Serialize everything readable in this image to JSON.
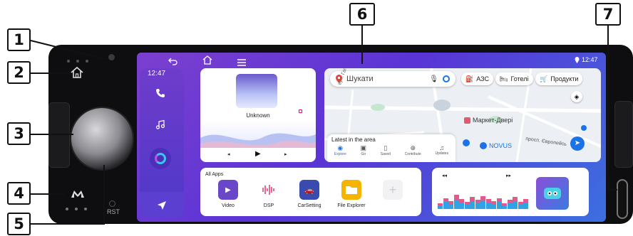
{
  "callouts": [
    "1",
    "2",
    "3",
    "4",
    "5",
    "6",
    "7"
  ],
  "device": {
    "rst_label": "RST",
    "brand_icon": "m-logo-icon"
  },
  "status_bar": {
    "time": "12:47",
    "location_icon": "location-pin-icon"
  },
  "sidebar": {
    "time": "12:47",
    "icons": [
      "phone-icon",
      "music-note-icon",
      "voice-assistant-icon",
      "navigation-arrow-icon"
    ]
  },
  "top_nav_icons": [
    "back-icon",
    "home-icon",
    "menu-icon"
  ],
  "music": {
    "title": "Unknown",
    "controls": [
      "previous-icon",
      "play-icon",
      "next-icon"
    ]
  },
  "map": {
    "search_placeholder": "Шукати",
    "chips": [
      "АЗС",
      "Готелі",
      "Продукти"
    ],
    "place_label": "Маркет-Двері",
    "poi_label": "NOVUS",
    "street_label": "просп. Європейсь",
    "street_vertical": "вул. Гагаріна",
    "latest_label": "Latest in the area",
    "bottom_tabs": [
      "Explore",
      "Go",
      "Saved",
      "Contribute",
      "Updates"
    ]
  },
  "apps": {
    "header": "All Apps",
    "items": [
      {
        "label": "Video",
        "color": "#6a47c9"
      },
      {
        "label": "DSP",
        "color": "#ffffff"
      },
      {
        "label": "CarSetting",
        "color": "#3a4bb0"
      },
      {
        "label": "File Explorer",
        "color": "#f4b400"
      }
    ]
  },
  "eq": {
    "controls": [
      "rewind-icon",
      "fast-forward-icon"
    ],
    "bar_levels": [
      0.3,
      0.55,
      0.4,
      0.7,
      0.5,
      0.35,
      0.6,
      0.45,
      0.65,
      0.5,
      0.4,
      0.55,
      0.3,
      0.45,
      0.6,
      0.35,
      0.5
    ]
  },
  "colors": {
    "screen_accent": "#6a3fd0",
    "eq_blue": "#2fa3e6",
    "eq_pink": "#e05a8a"
  }
}
